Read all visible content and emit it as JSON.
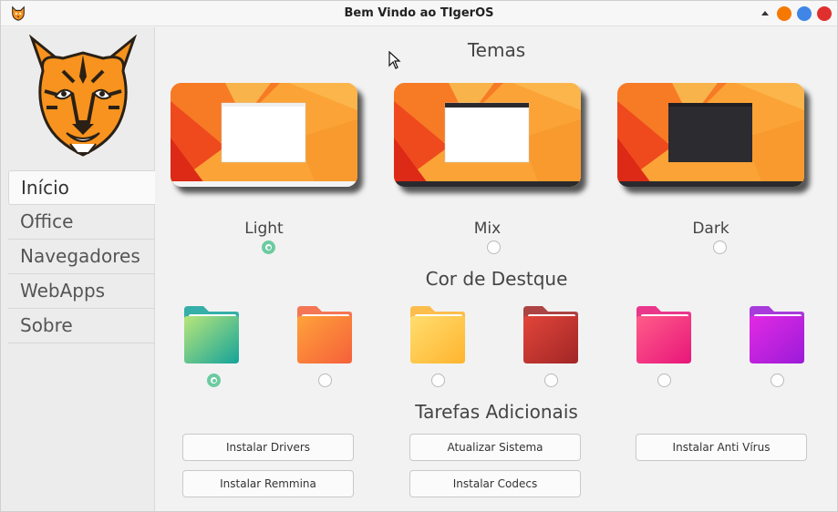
{
  "window": {
    "title": "Bem Vindo ao TIgerOS",
    "controls": {
      "close_color": "#e0302e",
      "maximize_color": "#3f86e6",
      "minimize_color": "#f57900"
    }
  },
  "sidebar": {
    "items": [
      {
        "label": "Início",
        "active": true
      },
      {
        "label": "Office",
        "active": false
      },
      {
        "label": "Navegadores",
        "active": false
      },
      {
        "label": "WebApps",
        "active": false
      },
      {
        "label": "Sobre",
        "active": false
      }
    ]
  },
  "themes": {
    "title": "Temas",
    "options": [
      {
        "label": "Light",
        "selected": true
      },
      {
        "label": "Mix",
        "selected": false
      },
      {
        "label": "Dark",
        "selected": false
      }
    ]
  },
  "accent": {
    "title": "Cor de Destque",
    "options": [
      {
        "name": "green-teal",
        "selected": true,
        "colors": [
          "#b9e67a",
          "#14a39a"
        ]
      },
      {
        "name": "orange",
        "selected": false,
        "colors": [
          "#ffa23a",
          "#f5603a"
        ]
      },
      {
        "name": "yellow",
        "selected": false,
        "colors": [
          "#ffdd6e",
          "#ffb42f"
        ]
      },
      {
        "name": "red",
        "selected": false,
        "colors": [
          "#e2453a",
          "#a12626"
        ]
      },
      {
        "name": "pink",
        "selected": false,
        "colors": [
          "#ff5c89",
          "#e8167a"
        ]
      },
      {
        "name": "purple",
        "selected": false,
        "colors": [
          "#e22ae4",
          "#9b1bd8"
        ]
      }
    ]
  },
  "tasks": {
    "title": "Tarefas Adicionais",
    "buttons": {
      "install_drivers": "Instalar Drivers",
      "update_system": "Atualizar Sistema",
      "install_antivirus": "Instalar Anti Vírus",
      "install_remmina": "Instalar Remmina",
      "install_codecs": "Instalar Codecs"
    }
  },
  "colors": {
    "radio_accent": "#6ccba1",
    "brand_orange": "#f7931e"
  }
}
